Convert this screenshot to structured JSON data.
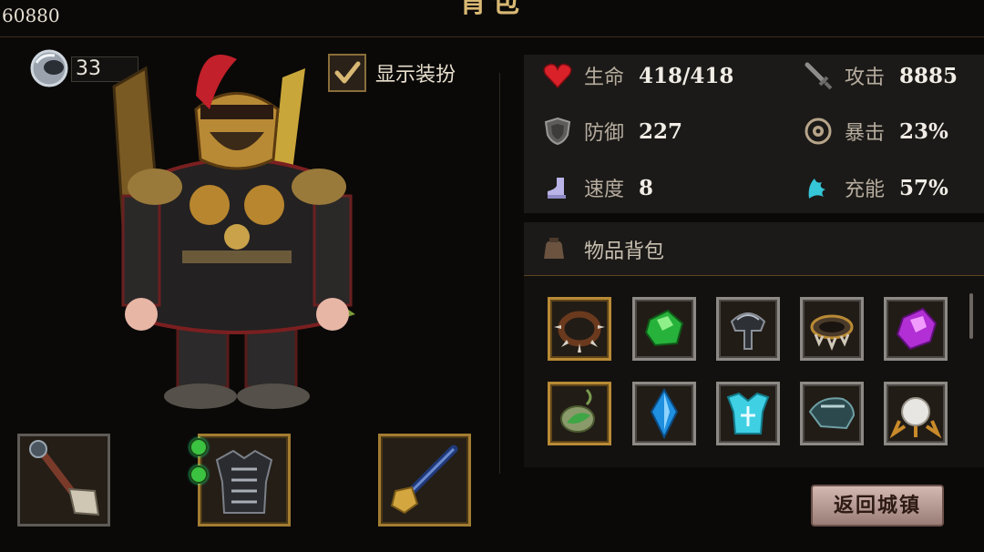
{
  "header": {
    "title": "背包",
    "currency": "60880"
  },
  "hero": {
    "level": "33"
  },
  "costume_toggle": {
    "label": "显示装扮",
    "checked": true
  },
  "stats": {
    "hp": {
      "label": "生命",
      "value": "418/418"
    },
    "attack": {
      "label": "攻击",
      "value": "8885"
    },
    "defense": {
      "label": "防御",
      "value": "227"
    },
    "crit": {
      "label": "暴击",
      "value": "23%"
    },
    "speed": {
      "label": "速度",
      "value": "8"
    },
    "charge": {
      "label": "充能",
      "value": "57%"
    }
  },
  "bag": {
    "title": "物品背包",
    "items": [
      {
        "name": "spiked-collar",
        "frame": "gold"
      },
      {
        "name": "green-gem",
        "frame": "silver"
      },
      {
        "name": "dark-helmet",
        "frame": "silver"
      },
      {
        "name": "spiked-bracer",
        "frame": "silver"
      },
      {
        "name": "purple-gem",
        "frame": "silver"
      },
      {
        "name": "leaf-amulet",
        "frame": "gold"
      },
      {
        "name": "blue-crystal",
        "frame": "silver"
      },
      {
        "name": "cyan-chestplate",
        "frame": "silver"
      },
      {
        "name": "dark-shoulder-armor",
        "frame": "silver"
      },
      {
        "name": "pearl-claw",
        "frame": "silver"
      }
    ]
  },
  "equipment": [
    {
      "name": "mace-weapon",
      "frame": "silver"
    },
    {
      "name": "black-armor",
      "frame": "gold",
      "sockets": 2
    },
    {
      "name": "golden-hammer",
      "frame": "gold"
    }
  ],
  "footer": {
    "return_label": "返回城镇"
  },
  "colors": {
    "accent_gold": "#b98a35",
    "panel": "#1b1a18",
    "button": "#c2a6a0"
  }
}
